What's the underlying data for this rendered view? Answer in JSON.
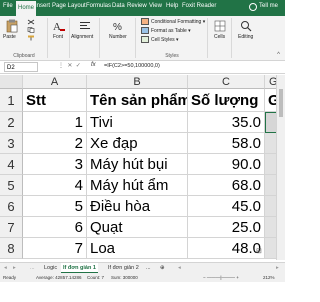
{
  "tabs": [
    "File",
    "Home",
    "Insert",
    "Page Layout",
    "Formulas",
    "Data",
    "Review",
    "View",
    "Help",
    "Foxit Reader",
    "Tell me"
  ],
  "ribbon": {
    "paste": "Paste",
    "font": "Font",
    "alignment": "Alignment",
    "number": "Number",
    "cond_format": "Conditional Formatting",
    "format_table": "Format as Table",
    "cell_styles": "Cell Styles",
    "cells": "Cells",
    "editing": "Editing",
    "groups": {
      "clipboard": "Clipboard",
      "styles": "Styles"
    }
  },
  "formula_bar": {
    "name_box": "D2",
    "fx": "fx",
    "formula": "=IF(C2>=50,100000,0)"
  },
  "columns": [
    "A",
    "B",
    "C",
    "Gi"
  ],
  "rows": [
    "1",
    "2",
    "3",
    "4",
    "5",
    "6",
    "7",
    "8"
  ],
  "table": {
    "headers": [
      "Stt",
      "Tên sản phẩm",
      "Số lượng",
      "Gi"
    ],
    "data": [
      [
        "1",
        "Tivi",
        "35.0"
      ],
      [
        "2",
        "Xe đạp",
        "58.0"
      ],
      [
        "3",
        "Máy hút bụi",
        "90.0"
      ],
      [
        "4",
        "Máy hút ẩm",
        "68.0"
      ],
      [
        "5",
        "Điều hòa",
        "45.0"
      ],
      [
        "6",
        "Quạt",
        "25.0"
      ],
      [
        "7",
        "Loa",
        "48.0"
      ]
    ]
  },
  "sheets": [
    "Logic",
    "If đơn giản 1",
    "If đơn giản 2"
  ],
  "status": {
    "ready": "Ready",
    "average": "Average: 42857.14286",
    "count": "Count: 7",
    "sum": "Sum: 300000",
    "zoom": "212%"
  },
  "colors": {
    "brand": "#217346"
  }
}
